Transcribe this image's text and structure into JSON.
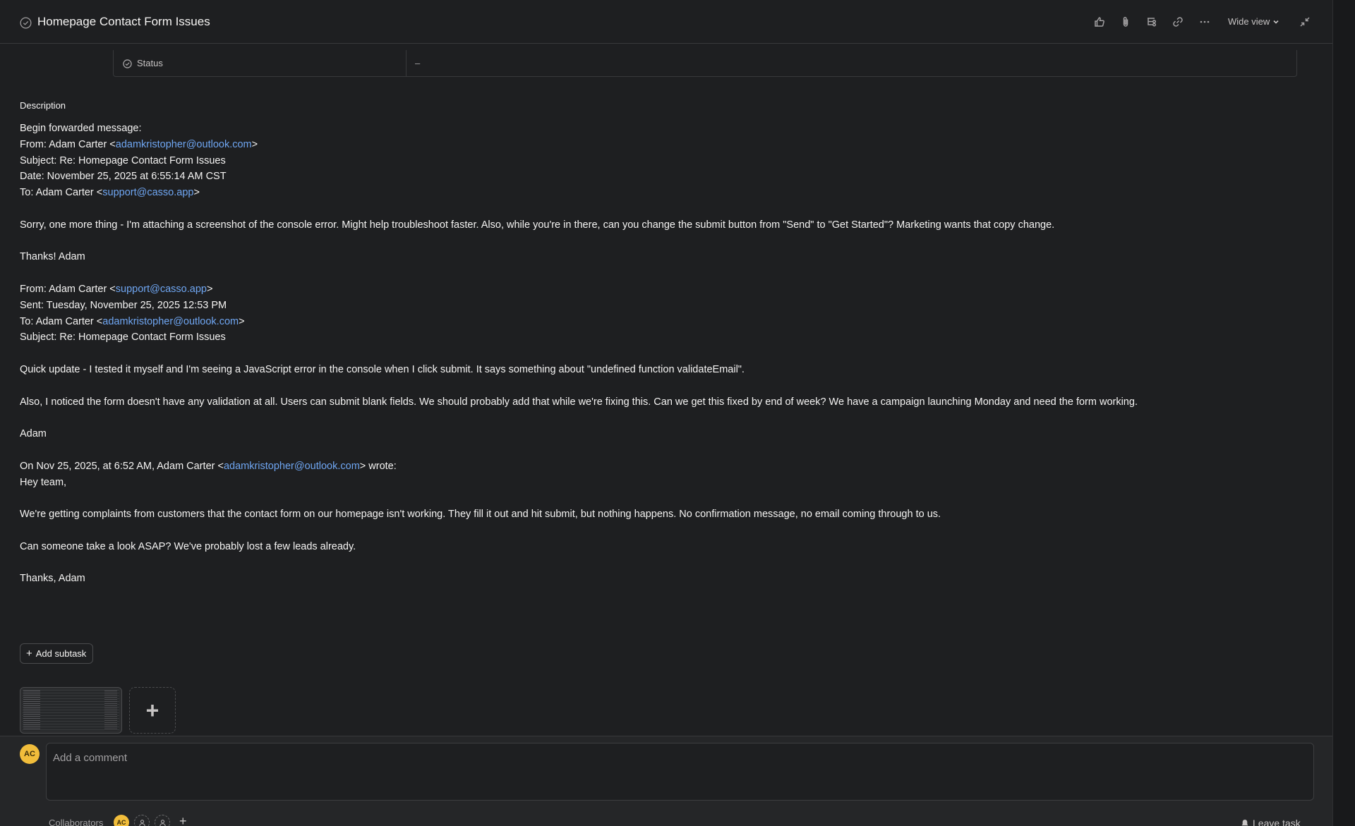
{
  "task": {
    "title": "Homepage Contact Form Issues"
  },
  "toolbar": {
    "wide_view_label": "Wide view"
  },
  "status_field": {
    "label": "Status",
    "value": "–"
  },
  "description": {
    "label": "Description",
    "lines": [
      {
        "segs": [
          {
            "t": "Begin forwarded message:"
          }
        ]
      },
      {
        "segs": [
          {
            "t": "From: Adam Carter <"
          },
          {
            "t": "adamkristopher@outlook.com",
            "link": true
          },
          {
            "t": ">"
          }
        ]
      },
      {
        "segs": [
          {
            "t": "Subject: Re: Homepage Contact Form Issues"
          }
        ]
      },
      {
        "segs": [
          {
            "t": "Date: November 25, 2025 at 6:55:14 AM CST"
          }
        ]
      },
      {
        "segs": [
          {
            "t": "To: Adam Carter <"
          },
          {
            "t": "support@casso.app",
            "link": true
          },
          {
            "t": ">"
          }
        ]
      },
      {
        "gap": true
      },
      {
        "segs": [
          {
            "t": "Sorry, one more thing - I'm attaching a screenshot of the console error. Might help troubleshoot faster. Also, while you're in there, can you change the submit button from \"Send\" to \"Get Started\"? Marketing wants that copy change."
          }
        ]
      },
      {
        "gap": true
      },
      {
        "segs": [
          {
            "t": "Thanks! Adam"
          }
        ]
      },
      {
        "gap": true
      },
      {
        "segs": [
          {
            "t": "From: Adam Carter <"
          },
          {
            "t": "support@casso.app",
            "link": true
          },
          {
            "t": ">"
          }
        ]
      },
      {
        "segs": [
          {
            "t": "Sent: Tuesday, November 25, 2025 12:53 PM"
          }
        ]
      },
      {
        "segs": [
          {
            "t": "To: Adam Carter <"
          },
          {
            "t": "adamkristopher@outlook.com",
            "link": true
          },
          {
            "t": ">"
          }
        ]
      },
      {
        "segs": [
          {
            "t": "Subject: Re: Homepage Contact Form Issues"
          }
        ]
      },
      {
        "gap": true
      },
      {
        "segs": [
          {
            "t": "Quick update - I tested it myself and I'm seeing a JavaScript error in the console when I click submit. It says something about \"undefined function validateEmail\"."
          }
        ]
      },
      {
        "gap": true
      },
      {
        "segs": [
          {
            "t": "Also, I noticed the form doesn't have any validation at all. Users can submit blank fields. We should probably add that while we're fixing this. Can we get this fixed by end of week? We have a campaign launching Monday and need the form working."
          }
        ]
      },
      {
        "gap": true
      },
      {
        "segs": [
          {
            "t": "Adam"
          }
        ]
      },
      {
        "gap": true
      },
      {
        "segs": [
          {
            "t": "On Nov 25, 2025, at 6:52 AM, Adam Carter <"
          },
          {
            "t": "adamkristopher@outlook.com",
            "link": true
          },
          {
            "t": "> wrote:"
          }
        ]
      },
      {
        "segs": [
          {
            "t": "Hey team,"
          }
        ]
      },
      {
        "gap": true
      },
      {
        "segs": [
          {
            "t": "We're getting complaints from customers that the contact form on our homepage isn't working. They fill it out and hit submit, but nothing happens. No confirmation message, no email coming through to us."
          }
        ]
      },
      {
        "gap": true
      },
      {
        "segs": [
          {
            "t": "Can someone take a look ASAP? We've probably lost a few leads already."
          }
        ]
      },
      {
        "gap": true
      },
      {
        "segs": [
          {
            "t": "Thanks, Adam"
          }
        ]
      }
    ]
  },
  "subtasks": {
    "add_label": "Add subtask"
  },
  "comments": {
    "avatar_initials": "AC",
    "placeholder": "Add a comment"
  },
  "collaborators": {
    "label": "Collaborators",
    "avatar_initials": "AC",
    "leave_label": "Leave task"
  },
  "colors": {
    "background": "#1e1f21",
    "link": "#6fa6f2",
    "avatar": "#f1bd3b"
  },
  "icons": [
    "check-circle-icon",
    "thumbs-up-icon",
    "paperclip-icon",
    "subtask-icon",
    "link-icon",
    "more-icon",
    "chevron-down-icon",
    "collapse-icon",
    "status-icon",
    "plus-icon",
    "user-icon",
    "bell-icon"
  ]
}
